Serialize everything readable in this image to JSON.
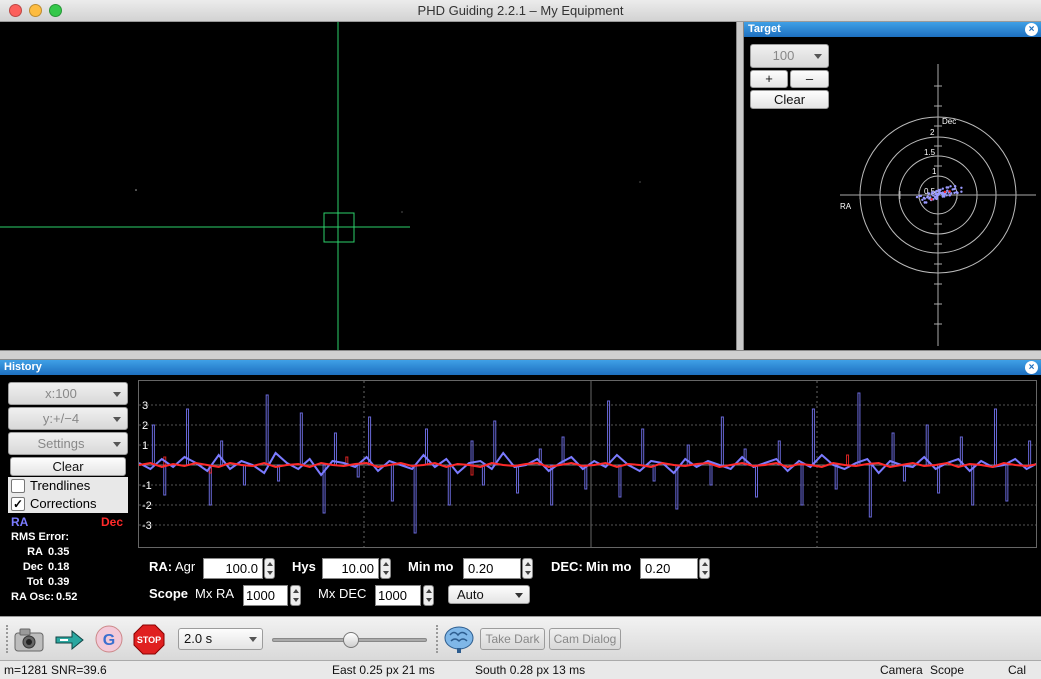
{
  "window": {
    "title": "PHD Guiding 2.2.1 – My Equipment"
  },
  "target": {
    "header": "Target",
    "zoom_value": "100",
    "plus_label": "+",
    "minus_label": "–",
    "clear_label": "Clear",
    "axis_dec_label": "Dec",
    "axis_ra_label": "RA",
    "ring_labels": [
      "2",
      "1.5",
      "1",
      "0.5"
    ]
  },
  "history": {
    "header": "History",
    "x_scale": "x:100",
    "y_scale": "y:+/−4",
    "settings_label": "Settings",
    "clear_label": "Clear",
    "trendlines_label": "Trendlines",
    "trendlines_checked": false,
    "corrections_label": "Corrections",
    "corrections_checked": true,
    "ra_legend": "RA",
    "dec_legend": "Dec",
    "ra_color": "#7b7bff",
    "dec_color": "#ff2a2a",
    "rms_title": "RMS Error:",
    "rms": [
      {
        "name": "RA",
        "value": "0.35"
      },
      {
        "name": "Dec",
        "value": "0.18"
      },
      {
        "name": "Tot",
        "value": "0.39"
      }
    ],
    "ra_osc_label": "RA Osc:",
    "ra_osc_value": "0.52",
    "y_ticks": [
      "3",
      "2",
      "1",
      "-1",
      "-2",
      "-3"
    ]
  },
  "chart_data": {
    "type": "line",
    "ylim": [
      -4,
      4
    ],
    "series": [
      {
        "name": "RA",
        "values": [
          0.1,
          -0.2,
          0.3,
          -0.1,
          0.4,
          0.1,
          -0.3,
          0.5,
          -0.2,
          0.2,
          0.0,
          -0.4,
          0.6,
          0.1,
          -0.2,
          0.3,
          -0.5,
          0.2,
          0.1,
          -0.1,
          0.4,
          -0.3,
          0.2,
          0.0,
          -0.2,
          0.5,
          -0.1,
          0.3,
          -0.4,
          0.1,
          0.2,
          -0.2,
          0.6,
          -0.1,
          0.0,
          0.3,
          -0.3,
          0.1,
          0.4,
          -0.2,
          0.2,
          -0.1,
          0.5,
          0.0,
          -0.3,
          0.2,
          0.1,
          -0.4,
          0.3,
          -0.1,
          0.2,
          0.0,
          -0.2,
          0.4,
          -0.1,
          0.1,
          0.3,
          -0.3,
          0.2,
          -0.1,
          0.5,
          0.0,
          -0.2,
          0.1,
          0.3,
          -0.4,
          0.2,
          0.0,
          -0.1,
          0.4,
          -0.2,
          0.1,
          0.3,
          -0.3,
          0.2,
          -0.1,
          0.0,
          0.3,
          -0.2,
          0.1
        ]
      },
      {
        "name": "Dec",
        "values": [
          0.0,
          0.1,
          -0.1,
          0.05,
          -0.05,
          0.1,
          0.0,
          -0.1,
          0.1,
          0.0,
          -0.05,
          0.1,
          -0.1,
          0.0,
          0.05,
          -0.1,
          0.1,
          0.0,
          -0.05,
          0.05,
          0.1,
          -0.1,
          0.0,
          0.1,
          -0.05,
          0.0,
          0.1,
          -0.1,
          0.05,
          0.0,
          -0.1,
          0.1,
          0.0,
          -0.05,
          0.05,
          0.1,
          -0.1,
          0.0,
          0.1,
          -0.05,
          0.0,
          0.1,
          -0.1,
          0.05,
          0.0,
          -0.1,
          0.1,
          0.0,
          -0.05,
          0.05,
          0.1,
          -0.1,
          0.0,
          0.1,
          -0.05,
          0.0,
          0.1,
          -0.1,
          0.05,
          0.0,
          -0.1,
          0.1,
          0.0,
          -0.05,
          0.05,
          0.1,
          -0.1,
          0.0,
          0.1,
          -0.05,
          0.0,
          0.1,
          -0.1,
          0.05,
          0.0,
          -0.1,
          0.1,
          0.0,
          -0.05,
          0.05
        ]
      }
    ],
    "corrections": [
      {
        "name": "RA",
        "values": [
          0.0,
          2.0,
          -1.5,
          0.0,
          2.8,
          0.0,
          -2.0,
          1.2,
          0.0,
          -1.0,
          0.0,
          3.5,
          -0.8,
          0.0,
          2.6,
          0.0,
          -2.4,
          1.6,
          0.0,
          -0.6,
          2.4,
          0.0,
          -1.8,
          0.0,
          -3.4,
          1.8,
          0.0,
          -2.0,
          0.0,
          1.2,
          -1.0,
          2.2,
          0.0,
          -1.4,
          0.0,
          0.8,
          -2.0,
          1.4,
          0.0,
          -1.2,
          0.0,
          3.2,
          -1.6,
          0.0,
          1.8,
          -0.8,
          0.0,
          -2.2,
          1.0,
          0.0,
          -1.0,
          2.4,
          0.0,
          0.8,
          -1.6,
          0.0,
          1.2,
          0.0,
          -2.0,
          2.8,
          0.0,
          -1.2,
          0.0,
          3.6,
          -2.6,
          0.0,
          1.6,
          -0.8,
          0.0,
          2.0,
          -1.4,
          0.0,
          1.4,
          -2.0,
          0.0,
          2.8,
          -1.8,
          0.0,
          1.2,
          -1.0
        ]
      },
      {
        "name": "Dec",
        "values": [
          0.0,
          0.0,
          0.4,
          0.0,
          0.0,
          0.0,
          -0.4,
          0.0,
          0.0,
          0.0,
          0.0,
          0.0,
          0.0,
          0.0,
          0.0,
          0.0,
          0.0,
          0.0,
          0.4,
          0.0,
          0.0,
          0.0,
          0.0,
          0.0,
          0.0,
          0.0,
          0.0,
          0.0,
          0.0,
          -0.5,
          0.0,
          0.0,
          0.0,
          0.0,
          0.0,
          0.0,
          0.0,
          0.0,
          0.0,
          0.0,
          0.0,
          0.0,
          0.0,
          0.0,
          0.0,
          0.0,
          0.0,
          0.0,
          0.0,
          0.0,
          0.0,
          0.0,
          0.0,
          0.0,
          0.0,
          0.0,
          0.0,
          0.0,
          0.0,
          0.0,
          0.0,
          0.0,
          0.5,
          0.0,
          0.0,
          0.0,
          0.0,
          0.0,
          0.0,
          0.0,
          0.0,
          0.0,
          0.0,
          0.0,
          0.0,
          0.0,
          0.0,
          0.0,
          0.0,
          0.4
        ]
      }
    ]
  },
  "params": {
    "ra_label": "RA:",
    "agr_label": "Agr",
    "agr_value": "100.0",
    "hys_label": "Hys",
    "hys_value": "10.00",
    "ra_minmo_label": "Min mo",
    "ra_minmo_value": "0.20",
    "dec_label": "DEC:",
    "dec_minmo_label": "Min mo",
    "dec_minmo_value": "0.20",
    "scope_label": "Scope",
    "mxra_label": "Mx RA",
    "mxra_value": "1000",
    "mxdec_label": "Mx DEC",
    "mxdec_value": "1000",
    "dec_mode_value": "Auto"
  },
  "toolbar": {
    "exposure_value": "2.0 s",
    "slider_level": 0.5,
    "take_dark_label": "Take Dark",
    "cam_dialog_label": "Cam Dialog",
    "stop_label": "STOP"
  },
  "status": {
    "star_info": "m=1281 SNR=39.6",
    "ra_guide": "East  0.25 px  21 ms",
    "dec_guide": "South 0.28 px 13 ms",
    "camera": "Camera",
    "scope": "Scope",
    "cal": "Cal"
  }
}
